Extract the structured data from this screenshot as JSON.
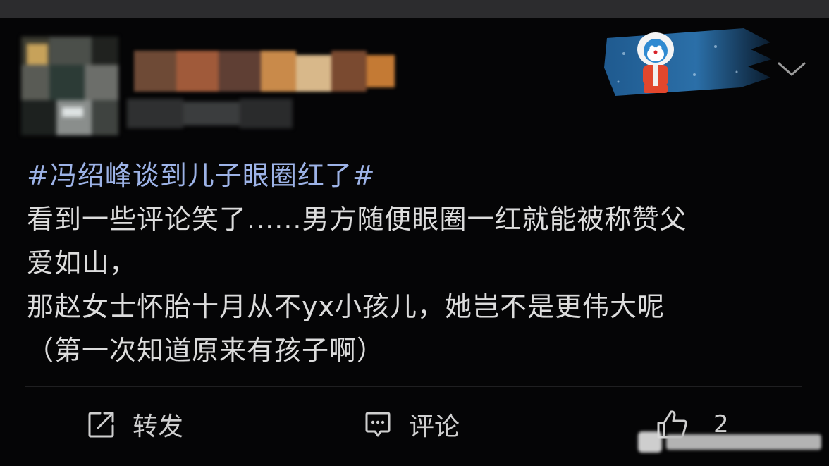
{
  "post": {
    "topic": "#冯绍峰谈到儿子眼圈红了#",
    "lines": [
      "看到一些评论笑了......男方随便眼圈一红就能被称赞父",
      "爱如山，",
      "那赵女士怀胎十月从不yx小孩儿，她岂不是更伟大呢",
      "（第一次知道原来有孩子啊）"
    ]
  },
  "actions": {
    "repost_label": "转发",
    "comment_label": "评论",
    "like_count": "2"
  },
  "icons": {
    "repost": "share-arrow-icon",
    "comment": "comment-bubble-icon",
    "like": "thumbs-up-icon",
    "more": "chevron-down-icon"
  },
  "colors": {
    "background": "#050506",
    "topic": "#9db3e7",
    "text": "#dcdcdc",
    "action": "#cfcfcf"
  }
}
